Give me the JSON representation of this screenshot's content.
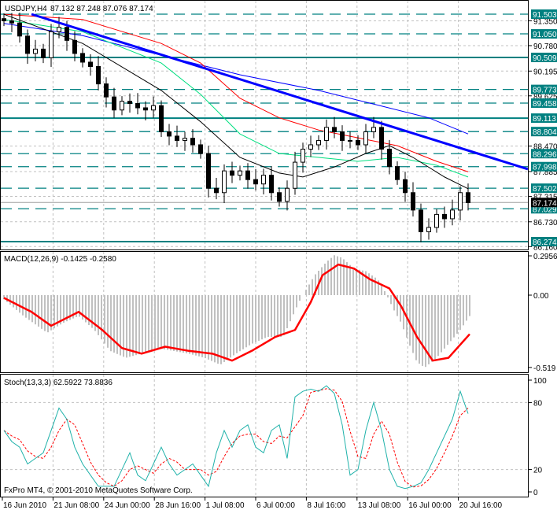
{
  "header": {
    "title": "USDJPY,H4",
    "ohlc": "87.132 87.248 87.076 87.174"
  },
  "macd_title": "MACD(12,26,9) -0.1425 -0.2580",
  "stoch_title": "Stoch(13,3,3) 62.5922 73.8836",
  "copyright": "FxPro MT4, © 2001-2010 MetaQuotes Software Corp.",
  "colors": {
    "level": "#008080",
    "trend": "#0000ff",
    "ma_red": "#ff0000",
    "ma_blue": "#0000ff",
    "ma_green": "#00e080",
    "ma_black": "#000000",
    "macd_hist": "#c0c0c0",
    "macd_signal": "#ff0000",
    "stoch_main": "#20b2aa",
    "stoch_signal": "#ff0000"
  },
  "chart_data": [
    {
      "type": "candlestick",
      "title": "USDJPY,H4",
      "ylim": [
        86.16,
        91.55
      ],
      "price_ticks": [
        "91.350",
        "90.780",
        "90.195",
        "89.625",
        "88.470",
        "87.885",
        "87.315",
        "86.730",
        "86.160"
      ],
      "levels_solid": [
        "90.509",
        "89.113",
        "86.274"
      ],
      "levels_dashed": [
        "91.503",
        "91.050",
        "89.773",
        "89.458",
        "88.804",
        "88.296",
        "87.998",
        "87.502",
        "87.029"
      ],
      "current_price": "87.174",
      "closes": [
        91.35,
        91.3,
        91.0,
        90.6,
        90.7,
        90.5,
        91.1,
        91.2,
        90.9,
        90.6,
        90.4,
        90.3,
        89.9,
        89.6,
        89.3,
        89.5,
        89.45,
        89.35,
        89.3,
        89.4,
        88.8,
        88.7,
        88.6,
        88.65,
        88.5,
        88.3,
        87.5,
        87.4,
        87.9,
        87.8,
        87.9,
        87.7,
        87.6,
        87.8,
        87.4,
        87.2,
        87.5,
        88.1,
        88.4,
        88.5,
        88.6,
        88.9,
        88.8,
        88.6,
        88.6,
        88.5,
        88.8,
        88.9,
        88.4,
        88.0,
        87.7,
        87.4,
        87.0,
        86.5,
        86.6,
        86.9,
        86.8,
        87.0,
        87.4,
        87.17
      ],
      "trendline": [
        [
          3.5,
          91.503
        ],
        [
          66.6,
          87.94
        ]
      ],
      "moving_averages": [
        {
          "color": "ma_blue",
          "points": [
            [
              0,
              91.29
            ],
            [
              10,
              91.01
            ],
            [
              20,
              90.56
            ],
            [
              30,
              90.11
            ],
            [
              40,
              89.75
            ],
            [
              48,
              89.39
            ],
            [
              54,
              89.12
            ],
            [
              59,
              88.75
            ]
          ]
        },
        {
          "color": "ma_red",
          "points": [
            [
              0,
              91.5
            ],
            [
              10,
              91.38
            ],
            [
              20,
              90.83
            ],
            [
              25,
              90.38
            ],
            [
              30,
              89.57
            ],
            [
              35,
              89.12
            ],
            [
              40,
              88.84
            ],
            [
              45,
              88.66
            ],
            [
              50,
              88.48
            ],
            [
              55,
              88.12
            ],
            [
              59,
              87.88
            ]
          ]
        },
        {
          "color": "ma_green",
          "points": [
            [
              0,
              91.38
            ],
            [
              10,
              91.1
            ],
            [
              20,
              90.38
            ],
            [
              25,
              89.66
            ],
            [
              30,
              88.75
            ],
            [
              35,
              88.3
            ],
            [
              40,
              88.21
            ],
            [
              45,
              88.12
            ],
            [
              50,
              88.21
            ],
            [
              55,
              88.03
            ],
            [
              59,
              87.76
            ]
          ]
        },
        {
          "color": "ma_black",
          "points": [
            [
              0,
              91.5
            ],
            [
              10,
              90.83
            ],
            [
              20,
              89.75
            ],
            [
              25,
              89.03
            ],
            [
              30,
              88.21
            ],
            [
              35,
              87.85
            ],
            [
              38,
              87.76
            ],
            [
              42,
              87.99
            ],
            [
              46,
              88.3
            ],
            [
              49,
              88.48
            ],
            [
              52,
              88.21
            ],
            [
              56,
              87.76
            ],
            [
              59,
              87.49
            ]
          ]
        }
      ],
      "time_labels": [
        "16 Jun 2010",
        "21 Jun 08:00",
        "24 Jun 00:00",
        "28 Jun 16:00",
        "1 Jul 08:00",
        "6 Jul 00:00",
        "8 Jul 16:00",
        "13 Jul 08:00",
        "16 Jul 00:00",
        "20 Jul 16:00"
      ]
    },
    {
      "type": "bar",
      "title": "MACD(12,26,9)",
      "ylim": [
        -0.519,
        0.2956
      ],
      "tick_labels": [
        "0.2956",
        "0.00",
        "-0.519"
      ],
      "histogram": [
        [
          0,
          -0.03
        ],
        [
          2.5,
          -0.15
        ],
        [
          5.5,
          -0.27
        ],
        [
          7.5,
          -0.2
        ],
        [
          9.5,
          -0.15
        ],
        [
          11.5,
          -0.25
        ],
        [
          13.5,
          -0.4
        ],
        [
          15.5,
          -0.45
        ],
        [
          17.5,
          -0.42
        ],
        [
          19.5,
          -0.38
        ],
        [
          21.5,
          -0.4
        ],
        [
          23.5,
          -0.42
        ],
        [
          25.5,
          -0.45
        ],
        [
          27.5,
          -0.5
        ],
        [
          29.5,
          -0.42
        ],
        [
          31.5,
          -0.35
        ],
        [
          33.5,
          -0.3
        ],
        [
          35.5,
          -0.3
        ],
        [
          37.5,
          -0.05
        ],
        [
          38.5,
          0.05
        ],
        [
          39.5,
          0.15
        ],
        [
          41,
          0.25
        ],
        [
          42,
          0.3
        ],
        [
          43,
          0.28
        ],
        [
          44.5,
          0.2
        ],
        [
          46,
          0.18
        ],
        [
          47.5,
          0.12
        ],
        [
          48.5,
          0.02
        ],
        [
          49.5,
          -0.1
        ],
        [
          50.5,
          -0.2
        ],
        [
          51.5,
          -0.35
        ],
        [
          52.5,
          -0.48
        ],
        [
          53.5,
          -0.52
        ],
        [
          55,
          -0.45
        ],
        [
          56.5,
          -0.35
        ],
        [
          58,
          -0.25
        ],
        [
          59.2,
          -0.15
        ]
      ],
      "signal": [
        [
          0,
          -0.02
        ],
        [
          3.5,
          -0.12
        ],
        [
          6,
          -0.22
        ],
        [
          9.5,
          -0.12
        ],
        [
          12.5,
          -0.25
        ],
        [
          15,
          -0.38
        ],
        [
          17.5,
          -0.42
        ],
        [
          20.5,
          -0.37
        ],
        [
          23.5,
          -0.4
        ],
        [
          26.5,
          -0.42
        ],
        [
          29,
          -0.47
        ],
        [
          31.5,
          -0.4
        ],
        [
          34.5,
          -0.3
        ],
        [
          37,
          -0.25
        ],
        [
          39,
          -0.05
        ],
        [
          40.5,
          0.15
        ],
        [
          42.5,
          0.23
        ],
        [
          44.5,
          0.2
        ],
        [
          46.5,
          0.12
        ],
        [
          49,
          0.05
        ],
        [
          50.5,
          -0.08
        ],
        [
          52.5,
          -0.3
        ],
        [
          54.5,
          -0.47
        ],
        [
          56.5,
          -0.45
        ],
        [
          59.2,
          -0.28
        ]
      ]
    },
    {
      "type": "line",
      "title": "Stoch(13,3,3)",
      "ylim": [
        0,
        100
      ],
      "tick_labels": [
        "100",
        "80",
        "20",
        "0"
      ],
      "main": [
        55,
        45,
        40,
        25,
        30,
        35,
        55,
        75,
        65,
        40,
        25,
        15,
        5,
        5,
        5,
        20,
        35,
        15,
        10,
        25,
        40,
        25,
        15,
        20,
        25,
        15,
        5,
        35,
        55,
        40,
        55,
        60,
        40,
        35,
        55,
        60,
        30,
        85,
        90,
        92,
        90,
        95,
        88,
        60,
        15,
        20,
        55,
        80,
        55,
        20,
        5,
        3,
        5,
        8,
        20,
        35,
        50,
        65,
        90,
        70
      ]
    }
  ]
}
